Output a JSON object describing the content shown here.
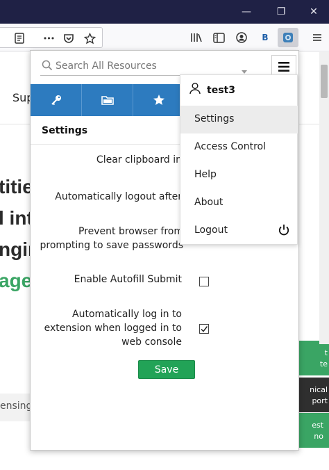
{
  "window": {
    "minimize_glyph": "—",
    "restore_glyph": "❐",
    "close_glyph": "✕"
  },
  "toolbar": {
    "overflow_glyph": "•••",
    "icons": [
      "page-icon",
      "pocket-icon",
      "bookmark-star-icon",
      "library-icon",
      "sidebar-icon",
      "account-icon",
      "b-extension-icon",
      "extension-icon",
      "menu-icon"
    ],
    "b_extension_label": "B"
  },
  "background": {
    "sup_text": "Sup",
    "line1": "titie",
    "line2": "l int",
    "line3": "ngin",
    "line4": "age",
    "licensing_text": "ensing",
    "side_tabs": [
      {
        "text": "t\nte",
        "color": "#3aa564"
      },
      {
        "text": "nical\nport",
        "color": "#2f2f2f"
      },
      {
        "text": "est\nno",
        "color": "#3aa564"
      }
    ]
  },
  "popup": {
    "search": {
      "placeholder": "Search All Resources",
      "value": ""
    },
    "tabs": [
      {
        "name": "credentials",
        "icon": "key-icon"
      },
      {
        "name": "folders",
        "icon": "folder-icon"
      },
      {
        "name": "favorites",
        "icon": "star-icon"
      }
    ],
    "settings_title": "Settings",
    "options": [
      {
        "label": "Clear clipboard in",
        "checkbox": null
      },
      {
        "label": "Automatically logout after",
        "checkbox": null
      },
      {
        "label": "Prevent browser from prompting to save passwords",
        "checkbox": null
      },
      {
        "label": "Enable Autofill Submit",
        "checkbox": false
      },
      {
        "label": "Automatically log in to extension when logged in to web console",
        "checkbox": true
      }
    ],
    "save_label": "Save",
    "colors": {
      "tabs_bar": "#2d7bbf",
      "save": "#22a357"
    }
  },
  "menu": {
    "username": "test3",
    "items": [
      {
        "label": "Settings",
        "active": true
      },
      {
        "label": "Access Control",
        "active": false
      },
      {
        "label": "Help",
        "active": false
      },
      {
        "label": "About",
        "active": false
      },
      {
        "label": "Logout",
        "active": false
      }
    ]
  }
}
